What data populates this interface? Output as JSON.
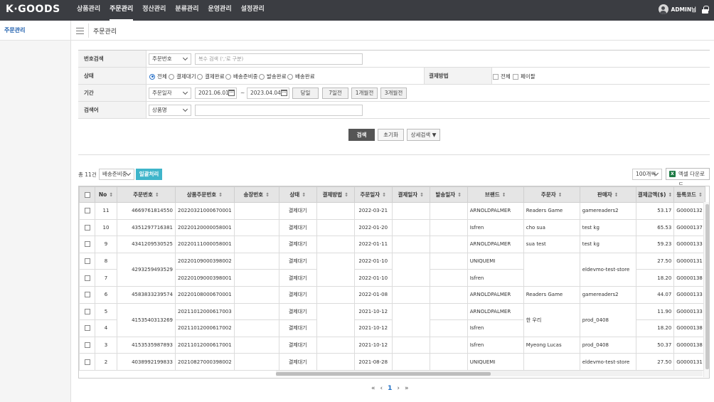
{
  "brand": {
    "logo": "K·GOODS"
  },
  "nav": [
    "상품관리",
    "주문관리",
    "정산관리",
    "분류관리",
    "운영관리",
    "설정관리"
  ],
  "user": {
    "name": "ADMIN님"
  },
  "sidebar": {
    "items": [
      "주문관리"
    ]
  },
  "page": {
    "title": "주문관리"
  },
  "filter": {
    "number_search": {
      "label": "번호검색",
      "select": "주문번호",
      "placeholder": "복수 검색 (','로 구분)"
    },
    "status": {
      "label": "상태",
      "options": [
        "전체",
        "결제대기",
        "결제완료",
        "배송준비중",
        "발송완료",
        "배송완료"
      ],
      "selected": "전체"
    },
    "payment": {
      "label": "결제방법",
      "options": [
        "전체",
        "페이팔"
      ]
    },
    "period": {
      "label": "기간",
      "select": "주문일자",
      "from": "2021.06.01",
      "sep": "~",
      "to": "2023.04.04",
      "quick": [
        "당일",
        "7일전",
        "1개월전",
        "3개월전"
      ]
    },
    "keyword": {
      "label": "검색어",
      "select": "상품명",
      "value": ""
    }
  },
  "actions": {
    "search": "검색",
    "reset": "초기화",
    "advanced": "상세검색 ▼"
  },
  "list": {
    "total": "총 11건",
    "bulk_status": "배송준비중",
    "bulk_button": "일괄처리",
    "page_size": "100개씩",
    "excel": "엑셀 다운로드"
  },
  "table": {
    "headers": [
      "No",
      "주문번호",
      "상품주문번호",
      "송장번호",
      "상태",
      "결제방법",
      "주문일자",
      "결제일자",
      "발송일자",
      "브랜드",
      "주문자",
      "판매자",
      "결제금액($)",
      "등록코드"
    ],
    "rows": [
      {
        "no": "11",
        "order_no": "4669761814550",
        "item_no": "20220321000670001",
        "invoice": "",
        "status": "결제대기",
        "pay_method": "",
        "order_date": "2022-03-21",
        "pay_date": "",
        "ship_date": "",
        "brand": "ARNOLDPALMER",
        "buyer": "Readers Game",
        "seller": "gamereaders2",
        "amount": "53.17",
        "code": "G0000132"
      },
      {
        "no": "10",
        "order_no": "4351297716381",
        "item_no": "20220120000058001",
        "invoice": "",
        "status": "결제대기",
        "pay_method": "",
        "order_date": "2022-01-20",
        "pay_date": "",
        "ship_date": "",
        "brand": "Isfren",
        "buyer": "cho sua",
        "seller": "test kg",
        "amount": "65.53",
        "code": "G0000137"
      },
      {
        "no": "9",
        "order_no": "4341209530525",
        "item_no": "20220111000058001",
        "invoice": "",
        "status": "결제대기",
        "pay_method": "",
        "order_date": "2022-01-11",
        "pay_date": "",
        "ship_date": "",
        "brand": "ARNOLDPALMER",
        "buyer": "sua test",
        "seller": "test kg",
        "amount": "59.23",
        "code": "G0000133"
      },
      {
        "no": "8",
        "order_no": "4293259493529",
        "item_no": "20220109000398002",
        "invoice": "",
        "status": "결제대기",
        "pay_method": "",
        "order_date": "2022-01-10",
        "pay_date": "",
        "ship_date": "",
        "brand": "UNIQUEMI",
        "buyer": "",
        "seller": "eldevmo-test-store",
        "amount": "27.50",
        "code": "G0000131"
      },
      {
        "no": "7",
        "order_no": "",
        "item_no": "20220109000398001",
        "invoice": "",
        "status": "결제대기",
        "pay_method": "",
        "order_date": "2022-01-10",
        "pay_date": "",
        "ship_date": "",
        "brand": "Isfren",
        "buyer": "",
        "seller": "",
        "amount": "18.20",
        "code": "G0000138"
      },
      {
        "no": "6",
        "order_no": "4583833239574",
        "item_no": "20220108000670001",
        "invoice": "",
        "status": "결제대기",
        "pay_method": "",
        "order_date": "2022-01-08",
        "pay_date": "",
        "ship_date": "",
        "brand": "ARNOLDPALMER",
        "buyer": "Readers Game",
        "seller": "gamereaders2",
        "amount": "44.07",
        "code": "G0000133"
      },
      {
        "no": "5",
        "order_no": "4153540313269",
        "item_no": "20211012000617003",
        "invoice": "",
        "status": "결제대기",
        "pay_method": "",
        "order_date": "2021-10-12",
        "pay_date": "",
        "ship_date": "",
        "brand": "ARNOLDPALMER",
        "buyer": "한 우리",
        "seller": "prod_0408",
        "amount": "11.90",
        "code": "G0000133"
      },
      {
        "no": "4",
        "order_no": "",
        "item_no": "20211012000617002",
        "invoice": "",
        "status": "결제대기",
        "pay_method": "",
        "order_date": "2021-10-12",
        "pay_date": "",
        "ship_date": "",
        "brand": "Isfren",
        "buyer": "",
        "seller": "",
        "amount": "18.20",
        "code": "G0000138"
      },
      {
        "no": "3",
        "order_no": "4153535987893",
        "item_no": "20211012000617001",
        "invoice": "",
        "status": "결제대기",
        "pay_method": "",
        "order_date": "2021-10-12",
        "pay_date": "",
        "ship_date": "",
        "brand": "Isfren",
        "buyer": "Myeong Lucas",
        "seller": "prod_0408",
        "amount": "50.37",
        "code": "G0000138"
      },
      {
        "no": "2",
        "order_no": "4038992199833",
        "item_no": "20210827000398002",
        "invoice": "",
        "status": "결제대기",
        "pay_method": "",
        "order_date": "2021-08-28",
        "pay_date": "",
        "ship_date": "",
        "brand": "UNIQUEMI",
        "buyer": "",
        "seller": "eldevmo-test-store",
        "amount": "27.50",
        "code": "G0000131"
      }
    ]
  },
  "pagination": {
    "first": "«",
    "prev": "‹",
    "current": "1",
    "next": "›",
    "last": "»"
  }
}
